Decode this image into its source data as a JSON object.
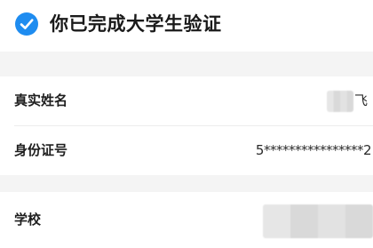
{
  "status": {
    "title": "你已完成大学生验证",
    "icon": "check-circle-icon",
    "accent_color": "#1e8cf0"
  },
  "identity_card": {
    "rows": [
      {
        "label": "真实姓名",
        "value": "飞"
      },
      {
        "label": "身份证号",
        "value": "5****************2"
      }
    ]
  },
  "school_card": {
    "rows": [
      {
        "label": "学校",
        "value": ""
      }
    ]
  }
}
